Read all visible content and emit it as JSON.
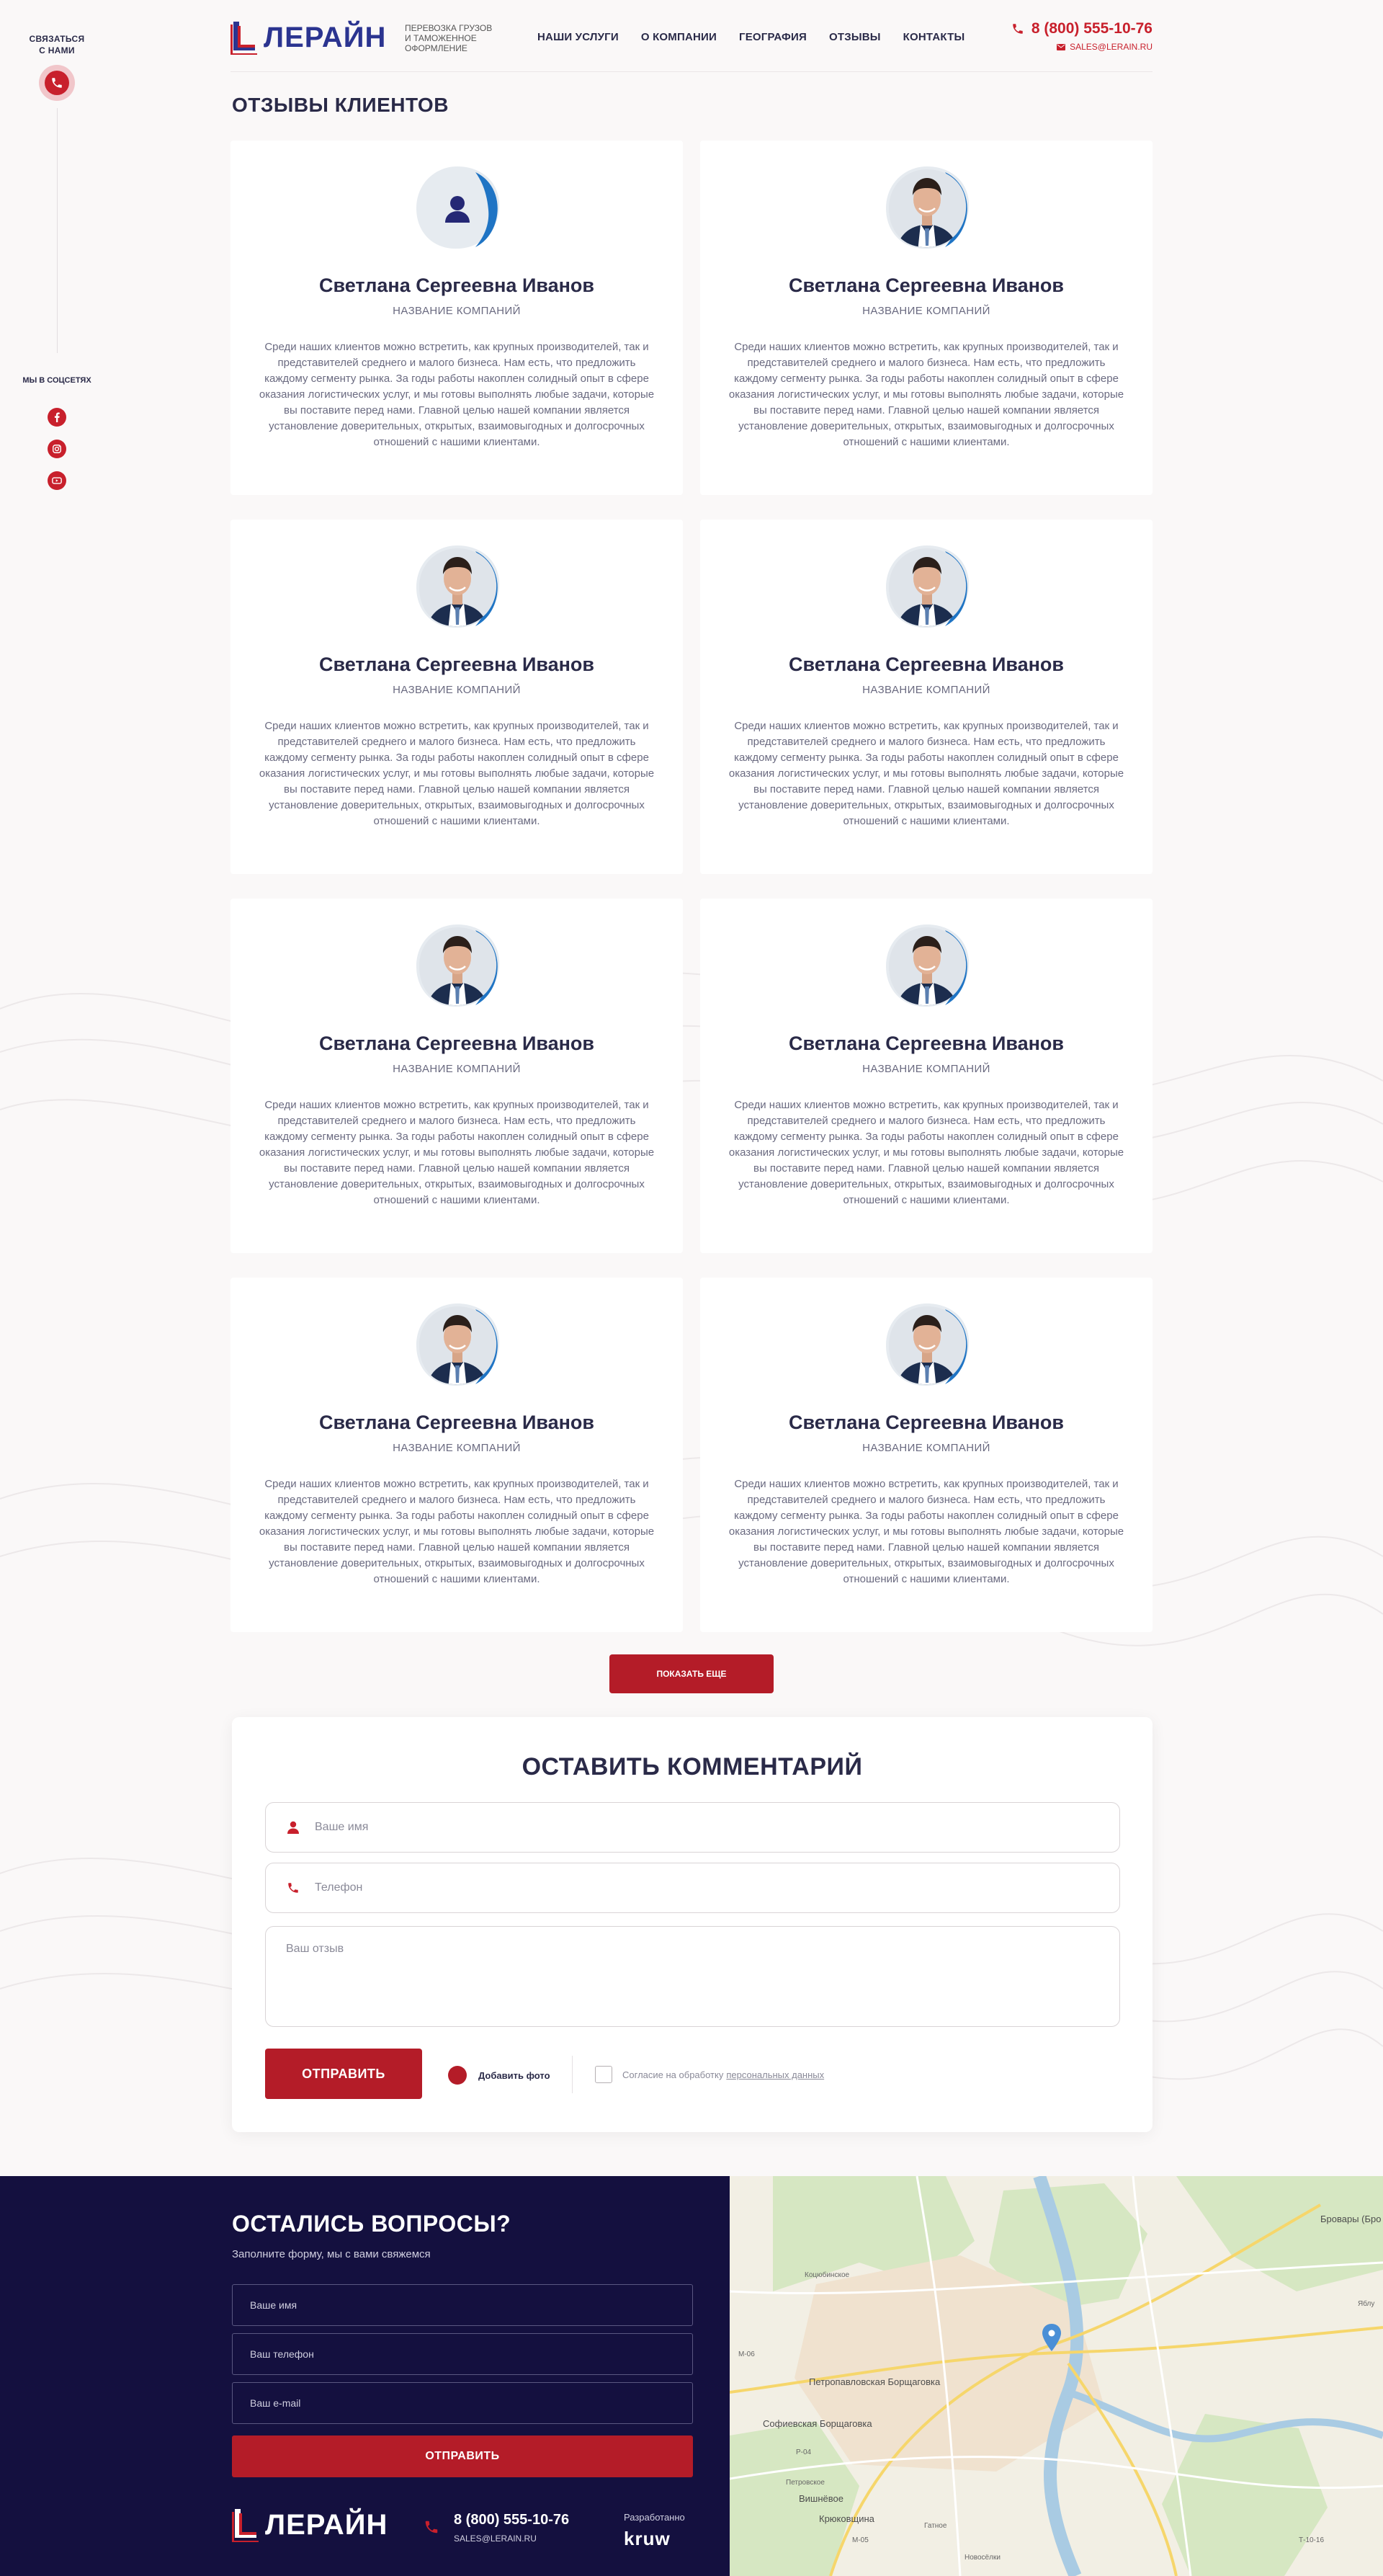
{
  "rail": {
    "contact_line1": "СВЯЗАТЬСЯ",
    "contact_line2": "С НАМИ",
    "social_title": "МЫ В СОЦСЕТЯХ",
    "social_icons": [
      "facebook-icon",
      "instagram-icon",
      "youtube-icon"
    ]
  },
  "header": {
    "logo": "ЛЕРАЙН",
    "tagline": [
      "ПЕРЕВОЗКА ГРУЗОВ",
      "И ТАМОЖЕННОЕ",
      "ОФОРМЛЕНИЕ"
    ],
    "nav": [
      "НАШИ УСЛУГИ",
      "О КОМПАНИИ",
      "ГЕОГРАФИЯ",
      "ОТЗЫВЫ",
      "КОНТАКТЫ"
    ],
    "phone": "8 (800) 555-10-76",
    "email": "SALES@LERAIN.RU"
  },
  "page_title": "ОТЗЫВЫ КЛИЕНТОВ",
  "reviews": [
    {
      "name": "Светлана Сергеевна Иванов",
      "company": "НАЗВАНИЕ КОМПАНИЙ",
      "avatar": "placeholder-user-icon",
      "text": "Среди наших клиентов можно встретить, как крупных производителей, так и представителей среднего и малого бизнеса. Нам есть, что предложить каждому сегменту рынка. За годы работы накоплен солидный опыт в сфере оказания логистических услуг, и мы готовы выполнять любые задачи, которые вы поставите перед нами. Главной целью нашей компании является установление доверительных, открытых, взаимовыгодных и долгосрочных отношений с нашими клиентами."
    },
    {
      "name": "Светлана Сергеевна Иванов",
      "company": "НАЗВАНИЕ КОМПАНИЙ",
      "avatar": "photo",
      "text": "Среди наших клиентов можно встретить, как крупных производителей, так и представителей среднего и малого бизнеса. Нам есть, что предложить каждому сегменту рынка. За годы работы накоплен солидный опыт в сфере оказания логистических услуг, и мы готовы выполнять любые задачи, которые вы поставите перед нами. Главной целью нашей компании является установление доверительных, открытых, взаимовыгодных и долгосрочных отношений с нашими клиентами."
    },
    {
      "name": "Светлана Сергеевна Иванов",
      "company": "НАЗВАНИЕ КОМПАНИЙ",
      "avatar": "photo",
      "text": "Среди наших клиентов можно встретить, как крупных производителей, так и представителей среднего и малого бизнеса. Нам есть, что предложить каждому сегменту рынка. За годы работы накоплен солидный опыт в сфере оказания логистических услуг, и мы готовы выполнять любые задачи, которые вы поставите перед нами. Главной целью нашей компании является установление доверительных, открытых, взаимовыгодных и долгосрочных отношений с нашими клиентами."
    },
    {
      "name": "Светлана Сергеевна Иванов",
      "company": "НАЗВАНИЕ КОМПАНИЙ",
      "avatar": "photo",
      "text": "Среди наших клиентов можно встретить, как крупных производителей, так и представителей среднего и малого бизнеса. Нам есть, что предложить каждому сегменту рынка. За годы работы накоплен солидный опыт в сфере оказания логистических услуг, и мы готовы выполнять любые задачи, которые вы поставите перед нами. Главной целью нашей компании является установление доверительных, открытых, взаимовыгодных и долгосрочных отношений с нашими клиентами."
    },
    {
      "name": "Светлана Сергеевна Иванов",
      "company": "НАЗВАНИЕ КОМПАНИЙ",
      "avatar": "photo",
      "text": "Среди наших клиентов можно встретить, как крупных производителей, так и представителей среднего и малого бизнеса. Нам есть, что предложить каждому сегменту рынка. За годы работы накоплен солидный опыт в сфере оказания логистических услуг, и мы готовы выполнять любые задачи, которые вы поставите перед нами. Главной целью нашей компании является установление доверительных, открытых, взаимовыгодных и долгосрочных отношений с нашими клиентами."
    },
    {
      "name": "Светлана Сергеевна Иванов",
      "company": "НАЗВАНИЕ КОМПАНИЙ",
      "avatar": "photo",
      "text": "Среди наших клиентов можно встретить, как крупных производителей, так и представителей среднего и малого бизнеса. Нам есть, что предложить каждому сегменту рынка. За годы работы накоплен солидный опыт в сфере оказания логистических услуг, и мы готовы выполнять любые задачи, которые вы поставите перед нами. Главной целью нашей компании является установление доверительных, открытых, взаимовыгодных и долгосрочных отношений с нашими клиентами."
    },
    {
      "name": "Светлана Сергеевна Иванов",
      "company": "НАЗВАНИЕ КОМПАНИЙ",
      "avatar": "photo",
      "text": "Среди наших клиентов можно встретить, как крупных производителей, так и представителей среднего и малого бизнеса. Нам есть, что предложить каждому сегменту рынка. За годы работы накоплен солидный опыт в сфере оказания логистических услуг, и мы готовы выполнять любые задачи, которые вы поставите перед нами. Главной целью нашей компании является установление доверительных, открытых, взаимовыгодных и долгосрочных отношений с нашими клиентами."
    },
    {
      "name": "Светлана Сергеевна Иванов",
      "company": "НАЗВАНИЕ КОМПАНИЙ",
      "avatar": "photo",
      "text": "Среди наших клиентов можно встретить, как крупных производителей, так и представителей среднего и малого бизнеса. Нам есть, что предложить каждому сегменту рынка. За годы работы накоплен солидный опыт в сфере оказания логистических услуг, и мы готовы выполнять любые задачи, которые вы поставите перед нами. Главной целью нашей компании является установление доверительных, открытых, взаимовыгодных и долгосрочных отношений с нашими клиентами."
    }
  ],
  "show_more": "ПОКАЗАТЬ ЕЩЕ",
  "comment_form": {
    "title": "ОСТАВИТЬ КОММЕНТАРИЙ",
    "name_placeholder": "Ваше имя",
    "phone_placeholder": "Телефон",
    "review_placeholder": "Ваш отзыв",
    "submit": "ОТПРАВИТЬ",
    "add_photo": "Добавить фото",
    "consent_text": "Согласие на обработку",
    "consent_link": "персональных данных"
  },
  "footer": {
    "title": "ОСТАЛИСЬ ВОПРОСЫ?",
    "subtitle": "Заполните форму, мы с вами свяжемся",
    "name_placeholder": "Ваше имя",
    "phone_placeholder": "Ваш телефон",
    "email_placeholder": "Ваш e-mail",
    "submit": "ОТПРАВИТЬ",
    "logo": "ЛЕРАЙН",
    "phone": "8 (800) 555-10-76",
    "email": "SALES@LERAIN.RU",
    "developed_by": "Разработанно",
    "developer": "kruw"
  },
  "map": {
    "labels": [
      "Бровары (Бро",
      "Коцюбинское",
      "Петропавловская Борщаговка",
      "Софиевская Борщаговка",
      "Вишнёвое",
      "Крюковщина",
      "Петровское",
      "Гатное",
      "Новосёлки",
      "Яблу"
    ],
    "road_labels": [
      "М-06",
      "Р-04",
      "М-05",
      "Т-10-16"
    ]
  },
  "colors": {
    "accent": "#b41c28",
    "navy": "#14103f",
    "logo_blue": "#2b3490"
  }
}
